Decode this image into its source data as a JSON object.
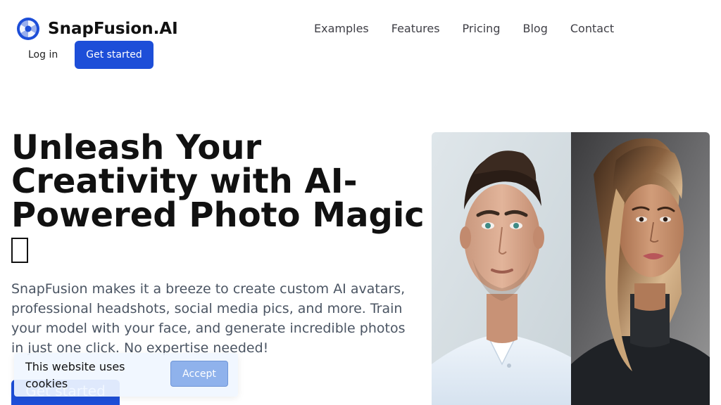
{
  "brand": {
    "name": "SnapFusion.AI"
  },
  "nav": {
    "items": [
      {
        "label": "Examples"
      },
      {
        "label": "Features"
      },
      {
        "label": "Pricing"
      },
      {
        "label": "Blog"
      },
      {
        "label": "Contact"
      }
    ]
  },
  "header": {
    "login_label": "Log in",
    "cta_label": "Get started"
  },
  "hero": {
    "title": "Unleash Your Creativity with AI-Powered Photo Magic",
    "description": "SnapFusion makes it a breeze to create custom AI avatars, professional headshots, social media pics, and more. Train your model with your face, and generate incredible photos in just one click. No expertise needed!",
    "cta_label": "Get started"
  },
  "cookie_banner": {
    "text": "This website uses cookies",
    "accept_label": "Accept"
  },
  "icons": {
    "logo": "camera-aperture-icon",
    "title_emoji": "missing-glyph-icon"
  },
  "colors": {
    "primary": "#1d4ed8",
    "text": "#111111",
    "muted": "#4b5563",
    "nav": "#3f3f46"
  }
}
